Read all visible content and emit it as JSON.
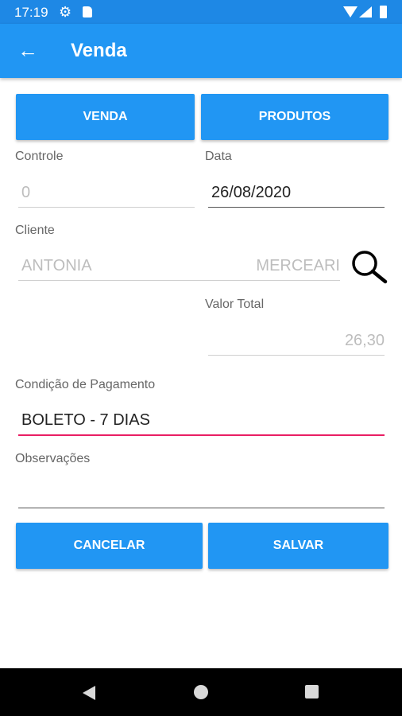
{
  "status_bar": {
    "time": "17:19"
  },
  "app_bar": {
    "title": "Venda"
  },
  "tabs": {
    "venda": "VENDA",
    "produtos": "PRODUTOS"
  },
  "form": {
    "controle_label": "Controle",
    "controle_value": "0",
    "data_label": "Data",
    "data_value": "26/08/2020",
    "cliente_label": "Cliente",
    "cliente_value": "ANTONIA",
    "cliente_value_right": "MERCEARI",
    "valor_total_label": "Valor Total",
    "valor_total_value": "26,30",
    "condicao_label": "Condição de Pagamento",
    "condicao_value": "BOLETO - 7 DIAS",
    "observacoes_label": "Observações",
    "observacoes_value": ""
  },
  "actions": {
    "cancelar": "CANCELAR",
    "salvar": "SALVAR"
  },
  "colors": {
    "primary": "#2196f3",
    "status_bar": "#1e88e5",
    "focus_underline": "#e91e63"
  },
  "icons": {
    "back": "arrow-left-icon",
    "search": "search-icon",
    "settings": "gear-icon",
    "sd_card": "sd-card-icon",
    "wifi": "wifi-icon",
    "signal": "signal-icon",
    "battery": "battery-icon"
  }
}
